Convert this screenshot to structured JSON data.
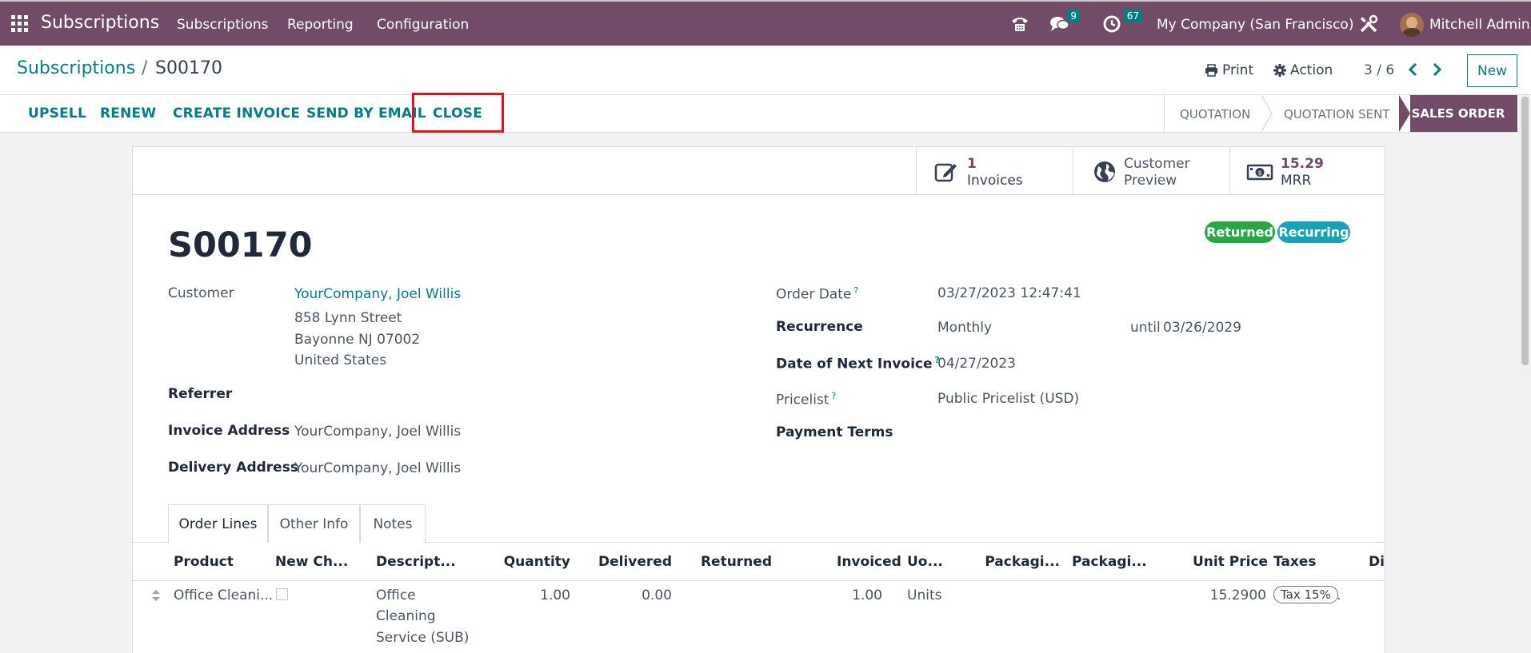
{
  "navbar": {
    "brand": "Subscriptions",
    "menu": [
      "Subscriptions",
      "Reporting",
      "Configuration"
    ],
    "messages_count": "9",
    "activities_count": "67",
    "company": "My Company (San Francisco)",
    "user": "Mitchell Admin"
  },
  "control_panel": {
    "breadcrumb_parent": "Subscriptions",
    "breadcrumb_separator": "/",
    "breadcrumb_current": "S00170",
    "print_label": "Print",
    "action_label": "Action",
    "pager": "3 / 6",
    "new_label": "New"
  },
  "statusbar": {
    "buttons": [
      "UPSELL",
      "RENEW",
      "CREATE INVOICE",
      "SEND BY EMAIL",
      "CLOSE"
    ],
    "stages": [
      "QUOTATION",
      "QUOTATION SENT",
      "SALES ORDER"
    ],
    "active_stage": "SALES ORDER"
  },
  "smart_buttons": {
    "invoices": {
      "count": "1",
      "label": "Invoices"
    },
    "customer_preview": {
      "line1": "Customer",
      "line2": "Preview"
    },
    "mrr": {
      "value": "15.29",
      "label": "MRR"
    }
  },
  "form": {
    "name": "S00170",
    "tags": [
      "Returned",
      "Recurring"
    ],
    "left": {
      "customer_label": "Customer",
      "customer_name": "YourCompany, Joel Willis",
      "address": [
        "858 Lynn Street",
        "Bayonne NJ 07002",
        "United States"
      ],
      "referrer_label": "Referrer",
      "invoice_address_label": "Invoice Address",
      "invoice_address": "YourCompany, Joel Willis",
      "delivery_address_label": "Delivery Address",
      "delivery_address": "YourCompany, Joel Willis"
    },
    "right": {
      "order_date_label": "Order Date",
      "order_date": "03/27/2023 12:47:41",
      "recurrence_label": "Recurrence",
      "recurrence": "Monthly",
      "until_label": "until",
      "until_date": "03/26/2029",
      "next_invoice_label": "Date of Next Invoice",
      "next_invoice": "04/27/2023",
      "pricelist_label": "Pricelist",
      "pricelist": "Public Pricelist (USD)",
      "payment_terms_label": "Payment Terms",
      "help_mark": "?"
    }
  },
  "tabs": [
    "Order Lines",
    "Other Info",
    "Notes"
  ],
  "order_lines": {
    "columns": [
      "Product",
      "New Ch...",
      "Descript...",
      "Quantity",
      "Delivered",
      "Returned",
      "Invoiced",
      "Uo...",
      "Packagi...",
      "Packagi...",
      "Unit Price",
      "Taxes",
      "Dis"
    ],
    "rows": [
      {
        "product": "Office Cleani...",
        "description": [
          "Office",
          "Cleaning",
          "Service (SUB)"
        ],
        "quantity": "1.00",
        "delivered": "0.00",
        "invoiced": "1.00",
        "uom": "Units",
        "unit_price": "15.2900",
        "tax": "Tax 15%",
        "trailing": "."
      }
    ]
  },
  "colors": {
    "brand": "#714b67",
    "accent": "#017e84",
    "returned_tag": "#28a745",
    "recurring_tag": "#17a2b8",
    "highlight": "#e0141e"
  },
  "icons": [
    "apps-grid-icon",
    "phone-icon",
    "chat-icon",
    "clock-icon",
    "tools-icon",
    "printer-icon",
    "gear-icon",
    "chevron-left-icon",
    "chevron-right-icon",
    "edit-icon",
    "globe-icon",
    "money-icon",
    "drag-handle-icon"
  ]
}
